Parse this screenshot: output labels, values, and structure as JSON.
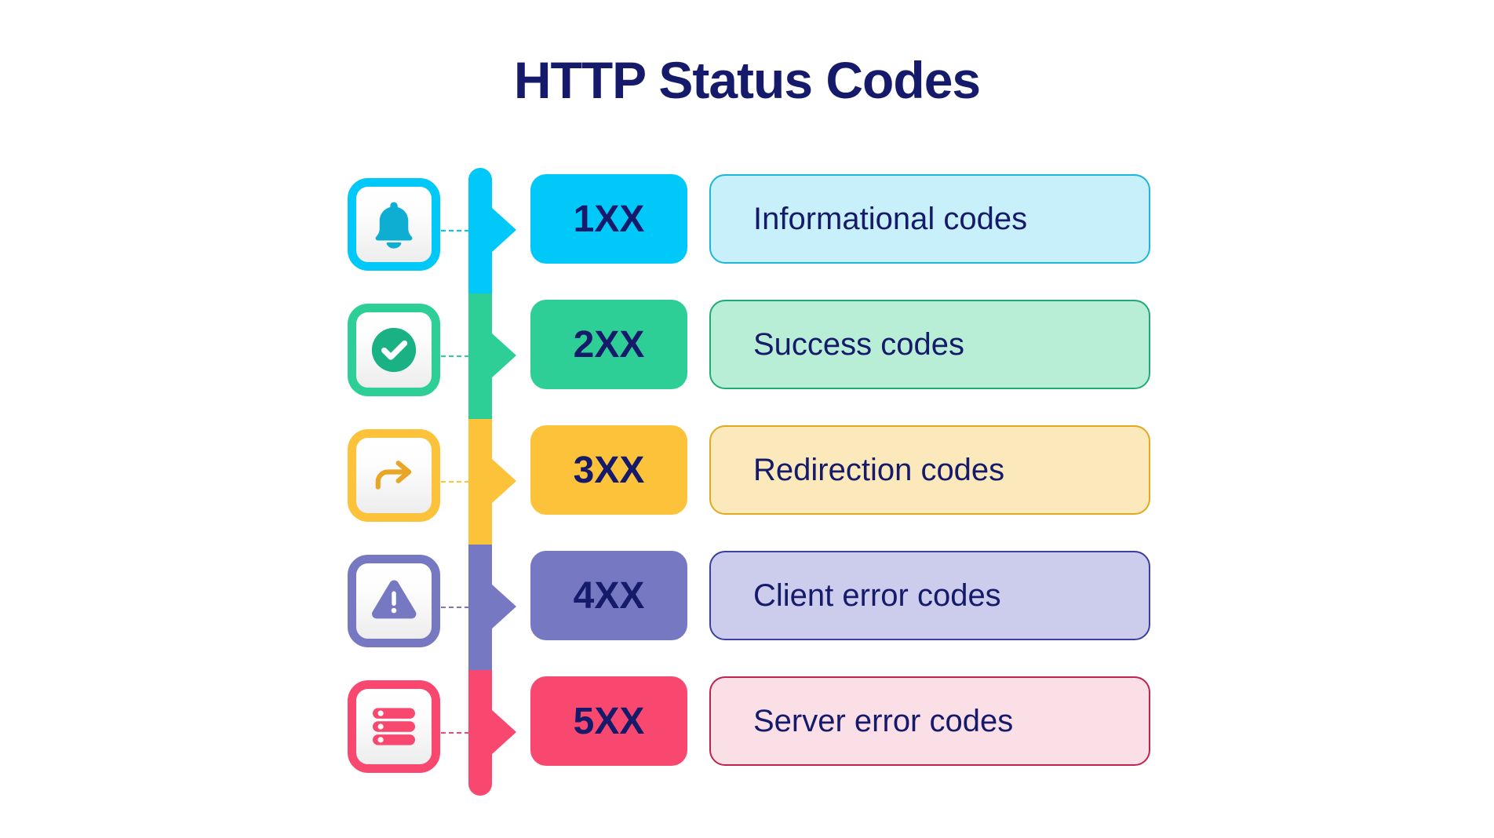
{
  "page": {
    "title": "HTTP Status Codes",
    "background": "#ffffff",
    "text_color": "#151a6a"
  },
  "rows": [
    {
      "code": "1XX",
      "description": "Informational codes",
      "icon": "bell-icon",
      "accent": "#00c8f8",
      "icon_color": "#0eaed2",
      "pill_fill": "#c8f0fb",
      "pill_border": "#1bb6da"
    },
    {
      "code": "2XX",
      "description": "Success codes",
      "icon": "check-circle-icon",
      "accent": "#2ecf96",
      "icon_color": "#1ab185",
      "pill_fill": "#b8eed6",
      "pill_border": "#1faa77"
    },
    {
      "code": "3XX",
      "description": "Redirection codes",
      "icon": "redirect-arrow-icon",
      "accent": "#fcc33a",
      "icon_color": "#e8a627",
      "pill_fill": "#fbe8bb",
      "pill_border": "#e0a91e"
    },
    {
      "code": "4XX",
      "description": "Client error codes",
      "icon": "warning-triangle-icon",
      "accent": "#7778c2",
      "icon_color": "#7778c2",
      "pill_fill": "#ccccec",
      "pill_border": "#3b3fa0"
    },
    {
      "code": "5XX",
      "description": "Server error codes",
      "icon": "server-stack-icon",
      "accent": "#f9486f",
      "icon_color": "#f9486f",
      "pill_fill": "#fbdfe6",
      "pill_border": "#c12250"
    }
  ]
}
